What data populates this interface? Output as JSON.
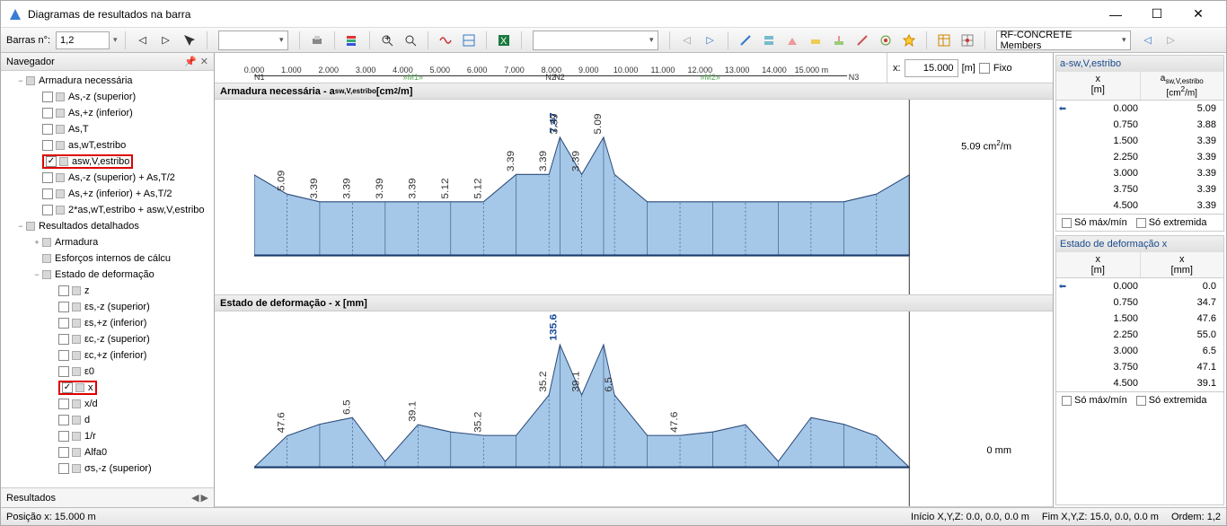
{
  "window": {
    "title": "Diagramas de resultados na barra"
  },
  "toolbar": {
    "barras_label": "Barras n°:",
    "barras_value": "1,2",
    "module": "RF-CONCRETE Members"
  },
  "navigator": {
    "title": "Navegador",
    "footer": "Resultados"
  },
  "tree": [
    {
      "depth": 0,
      "toggle": "−",
      "square": true,
      "label": "Armadura necessária"
    },
    {
      "depth": 1,
      "chk": false,
      "square": true,
      "label": "As,-z (superior)"
    },
    {
      "depth": 1,
      "chk": false,
      "square": true,
      "label": "As,+z (inferior)"
    },
    {
      "depth": 1,
      "chk": false,
      "square": true,
      "label": "As,T"
    },
    {
      "depth": 1,
      "chk": false,
      "square": true,
      "label": "as,wT,estribo"
    },
    {
      "depth": 1,
      "chk": true,
      "square": true,
      "label": "asw,V,estribo",
      "highlight": true
    },
    {
      "depth": 1,
      "chk": false,
      "square": true,
      "label": "As,-z (superior) + As,T/2"
    },
    {
      "depth": 1,
      "chk": false,
      "square": true,
      "label": "As,+z (inferior) + As,T/2"
    },
    {
      "depth": 1,
      "chk": false,
      "square": true,
      "label": "2*as,wT,estribo + asw,V,estribo"
    },
    {
      "depth": 0,
      "toggle": "−",
      "square": true,
      "label": "Resultados detalhados"
    },
    {
      "depth": 1,
      "toggle": "+",
      "square": true,
      "label": "Armadura"
    },
    {
      "depth": 1,
      "toggle": "",
      "square": true,
      "label": "Esforços internos de cálcu"
    },
    {
      "depth": 1,
      "toggle": "−",
      "square": true,
      "label": "Estado de deformação"
    },
    {
      "depth": 2,
      "chk": false,
      "square": true,
      "label": "z"
    },
    {
      "depth": 2,
      "chk": false,
      "square": true,
      "label": "εs,-z (superior)"
    },
    {
      "depth": 2,
      "chk": false,
      "square": true,
      "label": "εs,+z (inferior)"
    },
    {
      "depth": 2,
      "chk": false,
      "square": true,
      "label": "εc,-z (superior)"
    },
    {
      "depth": 2,
      "chk": false,
      "square": true,
      "label": "εc,+z (inferior)"
    },
    {
      "depth": 2,
      "chk": false,
      "square": true,
      "label": "ε0"
    },
    {
      "depth": 2,
      "chk": true,
      "square": true,
      "label": "x",
      "highlight": true
    },
    {
      "depth": 2,
      "chk": false,
      "square": true,
      "label": "x/d"
    },
    {
      "depth": 2,
      "chk": false,
      "square": true,
      "label": "d"
    },
    {
      "depth": 2,
      "chk": false,
      "square": true,
      "label": "1/r"
    },
    {
      "depth": 2,
      "chk": false,
      "square": true,
      "label": "Alfa0"
    },
    {
      "depth": 2,
      "chk": false,
      "square": true,
      "label": "σs,-z (superior)"
    }
  ],
  "ruler": {
    "ticks": [
      "0.000",
      "1.000",
      "2.000",
      "3.000",
      "4.000",
      "5.000",
      "6.000",
      "7.000",
      "8.000",
      "9.000",
      "10.000",
      "11.000",
      "12.000",
      "13.000",
      "14.000",
      "15.000 m"
    ],
    "markers": [
      {
        "pos": 0.0,
        "label": "N1"
      },
      {
        "pos": 0.25,
        "label": "»M1»"
      },
      {
        "pos": 0.49,
        "label": "N2"
      },
      {
        "pos": 0.505,
        "label": "N2"
      },
      {
        "pos": 0.75,
        "label": "»M2»"
      },
      {
        "pos": 1.0,
        "label": "N3"
      }
    ],
    "x_label": "x:",
    "x_value": "15.000",
    "x_unit": "[m]",
    "fixo": "Fixo"
  },
  "diagrams": {
    "top": {
      "title": "Armadura necessária - a sw,V,estribo [cm²/m]",
      "peak": "7.47",
      "right_label": "5.09 cm²/m",
      "values_text": [
        "5.09",
        "3.39",
        "3.39",
        "3.39",
        "3.39",
        "5.12",
        "5.12",
        "3.39",
        "3.39",
        "3.39",
        "3.39",
        "5.09"
      ]
    },
    "bottom": {
      "title": "Estado de deformação - x [mm]",
      "peak": "135.6",
      "right_label": "0 mm",
      "values_text": [
        "47.6",
        "6.5",
        "39.1",
        "35.2",
        "35.2",
        "39.1",
        "6.5",
        "47.6"
      ]
    }
  },
  "chart_data": [
    {
      "type": "area",
      "title": "Armadura necessária - a sw,V,estribo [cm²/m]",
      "xlabel": "x [m]",
      "ylabel": "a_sw,V,estribo [cm²/m]",
      "x": [
        0.0,
        0.75,
        1.5,
        2.25,
        3.0,
        3.75,
        4.5,
        5.25,
        6.0,
        6.75,
        7.0,
        7.5,
        8.0,
        8.25,
        9.0,
        9.75,
        10.5,
        11.25,
        12.0,
        12.75,
        13.5,
        14.25,
        15.0
      ],
      "values": [
        5.09,
        3.88,
        3.39,
        3.39,
        3.39,
        3.39,
        3.39,
        3.39,
        5.12,
        5.12,
        7.47,
        5.12,
        7.47,
        5.12,
        3.39,
        3.39,
        3.39,
        3.39,
        3.39,
        3.39,
        3.39,
        3.88,
        5.09
      ],
      "ylim": [
        0,
        8
      ]
    },
    {
      "type": "area",
      "title": "Estado de deformação - x [mm]",
      "xlabel": "x [m]",
      "ylabel": "x [mm]",
      "x": [
        0.0,
        0.75,
        1.5,
        2.25,
        3.0,
        3.75,
        4.5,
        5.25,
        6.0,
        6.75,
        7.0,
        7.5,
        8.0,
        8.25,
        9.0,
        9.75,
        10.5,
        11.25,
        12.0,
        12.75,
        13.5,
        14.25,
        15.0
      ],
      "values": [
        0.0,
        34.7,
        47.6,
        55.0,
        6.5,
        47.1,
        39.1,
        35.2,
        35.2,
        80.0,
        135.6,
        80.0,
        135.6,
        80.0,
        35.2,
        35.2,
        39.1,
        47.1,
        6.5,
        55.0,
        47.6,
        34.7,
        0.0
      ],
      "ylim": [
        0,
        140
      ]
    }
  ],
  "right": {
    "sec1": {
      "title": "a-sw,V,estribo",
      "col1": "x",
      "col1u": "[m]",
      "col2": "a sw,V,estribo",
      "col2u": "[cm²/m]",
      "rows": [
        {
          "pin": true,
          "x": "0.000",
          "y": "5.09"
        },
        {
          "x": "0.750",
          "y": "3.88"
        },
        {
          "x": "1.500",
          "y": "3.39"
        },
        {
          "x": "2.250",
          "y": "3.39"
        },
        {
          "x": "3.000",
          "y": "3.39"
        },
        {
          "x": "3.750",
          "y": "3.39"
        },
        {
          "x": "4.500",
          "y": "3.39"
        }
      ]
    },
    "sec2": {
      "title": "Estado de deformação x",
      "col1": "x",
      "col1u": "[m]",
      "col2": "x",
      "col2u": "[mm]",
      "rows": [
        {
          "pin": true,
          "x": "0.000",
          "y": "0.0"
        },
        {
          "x": "0.750",
          "y": "34.7"
        },
        {
          "x": "1.500",
          "y": "47.6"
        },
        {
          "x": "2.250",
          "y": "55.0"
        },
        {
          "x": "3.000",
          "y": "6.5"
        },
        {
          "x": "3.750",
          "y": "47.1"
        },
        {
          "x": "4.500",
          "y": "39.1"
        }
      ]
    },
    "foot1": "Só máx/mín",
    "foot2": "Só extremida"
  },
  "status": {
    "left": "Posição x: 15.000 m",
    "r1": "Início X,Y,Z:",
    "r1v": "0.0, 0.0, 0.0 m",
    "r2": "Fim X,Y,Z:",
    "r2v": "15.0, 0.0, 0.0 m",
    "r3": "Ordem:",
    "r3v": "1,2"
  }
}
